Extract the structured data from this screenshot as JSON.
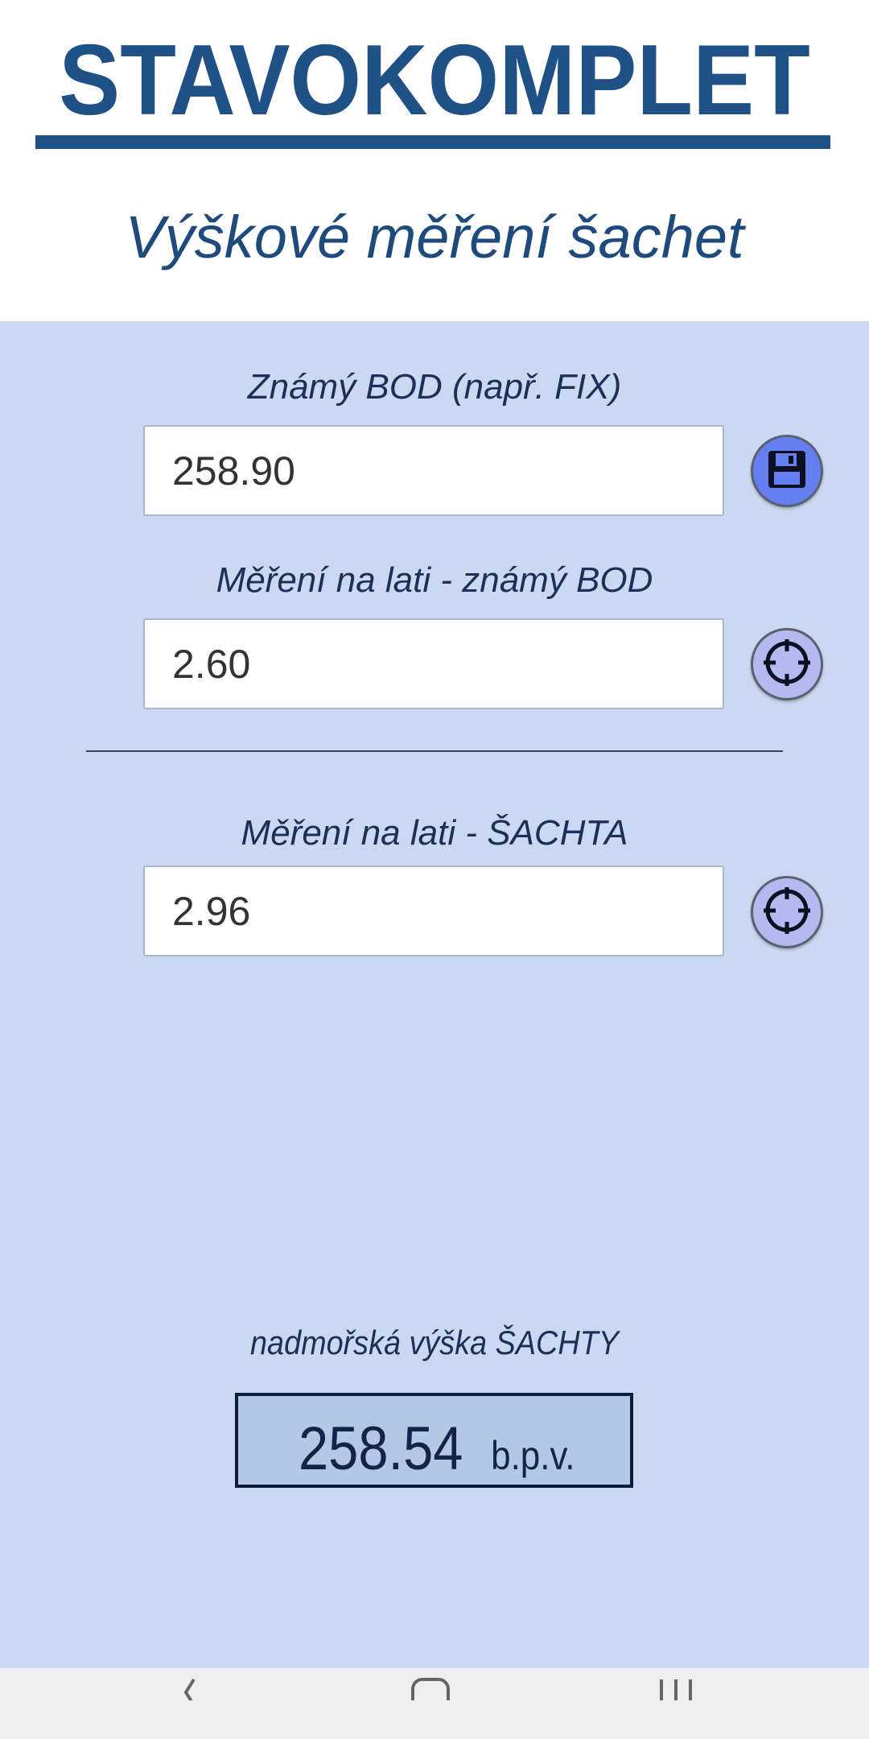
{
  "header": {
    "logo_text": "STAVOKOMPLET",
    "title": "Výškové měření šachet"
  },
  "fields": {
    "known_point": {
      "label": "Známý BOD (např. FIX)",
      "value": "258.90"
    },
    "staff_known": {
      "label": "Měření na lati - známý BOD",
      "value": "2.60"
    },
    "staff_shaft": {
      "label": "Měření na lati - ŠACHTA",
      "value": "2.96"
    }
  },
  "result": {
    "label": "nadmořská výška ŠACHTY",
    "value": "258.54",
    "unit": "b.p.v."
  },
  "icons": {
    "save": "floppy-disk-icon",
    "target": "crosshair-icon",
    "nav_back": "back-chevron-icon",
    "nav_home": "home-icon",
    "nav_recents": "recents-icon"
  },
  "colors": {
    "brand": "#1f5086",
    "panel_background": "#cbd8f1",
    "save_button": "#6480f0",
    "target_button": "#b4baf0",
    "result_box": "#b5c7e6"
  }
}
